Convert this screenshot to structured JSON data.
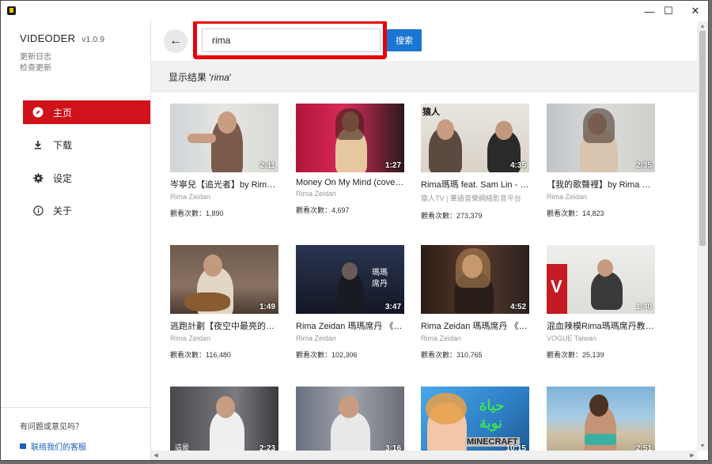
{
  "window": {
    "minimize_icon": "minimize-icon",
    "maximize_icon": "maximize-icon",
    "close_icon": "close-icon"
  },
  "sidebar": {
    "app_name": "VIDEODER",
    "version": "v1.0.9",
    "links": [
      "更新日志",
      "检查更新"
    ],
    "nav": [
      {
        "label": "主页",
        "icon": "compass-icon",
        "active": true
      },
      {
        "label": "下载",
        "icon": "download-icon",
        "active": false
      },
      {
        "label": "设定",
        "icon": "gear-icon",
        "active": false
      },
      {
        "label": "关于",
        "icon": "info-icon",
        "active": false
      }
    ],
    "feedback": "有问题或意见吗？",
    "support": "联络我们的客服"
  },
  "search": {
    "value": "rima",
    "button_label": "搜索",
    "results_prefix": "显示结果 '",
    "results_query": "rima",
    "results_suffix": "'"
  },
  "colors": {
    "accent": "#d0121b",
    "search_button": "#1976d2",
    "highlight": "#e8000b"
  },
  "videos": [
    {
      "title": "岑寧兒【追光者】by Rima Zeidan",
      "channel": "Rima Zeidan",
      "views": "觀看次數：1,890",
      "duration": "2:11"
    },
    {
      "title": "Money On My Mind (cover) - Rima Zeidan",
      "channel": "Rima Zeidan",
      "views": "觀看次數：4,697",
      "duration": "1:27"
    },
    {
      "title": "Rima瑪瑪 feat. Sam Lin - 說好的幸福呢",
      "channel": "猿人TV | 華語音樂網絡影音平台",
      "views": "觀看次數：273,379",
      "duration": "4:35"
    },
    {
      "title": "【我的歌聲裡】by Rima Zeidan",
      "channel": "Rima Zeidan",
      "views": "觀看次數：14,823",
      "duration": "2:35"
    },
    {
      "title": "逃跑計劃【夜空中最亮的星】by Rima Zeidan",
      "channel": "Rima Zeidan",
      "views": "觀看次數：116,480",
      "duration": "1:49"
    },
    {
      "title": "Rima Zeidan 瑪瑪席丹 《Orbit》",
      "channel": "Rima Zeidan",
      "views": "觀看次數：102,306",
      "duration": "3:47"
    },
    {
      "title": "Rima Zeidan 瑪瑪席丹 《Just Begun》",
      "channel": "Rima Zeidan",
      "views": "觀看次數：310,765",
      "duration": "4:52"
    },
    {
      "title": "混血辣模Rima瑪瑪席丹教你健身",
      "channel": "VOGUE Taiwan",
      "views": "觀看次數：25,139",
      "duration": "1:40"
    },
    {
      "title": "",
      "channel": "",
      "views": "",
      "duration": "2:23"
    },
    {
      "title": "",
      "channel": "",
      "views": "",
      "duration": "3:16"
    },
    {
      "title": "",
      "channel": "",
      "views": "",
      "duration": "10:15"
    },
    {
      "title": "",
      "channel": "",
      "views": "",
      "duration": "2:51"
    }
  ],
  "thumb_overlays": {
    "t3": "猿人",
    "t6a": "瑪瑪",
    "t6b": "席丹",
    "t11a": "حياة",
    "t11b": "نوبة",
    "t11c": "MINECRAFT",
    "t9": "這是"
  }
}
